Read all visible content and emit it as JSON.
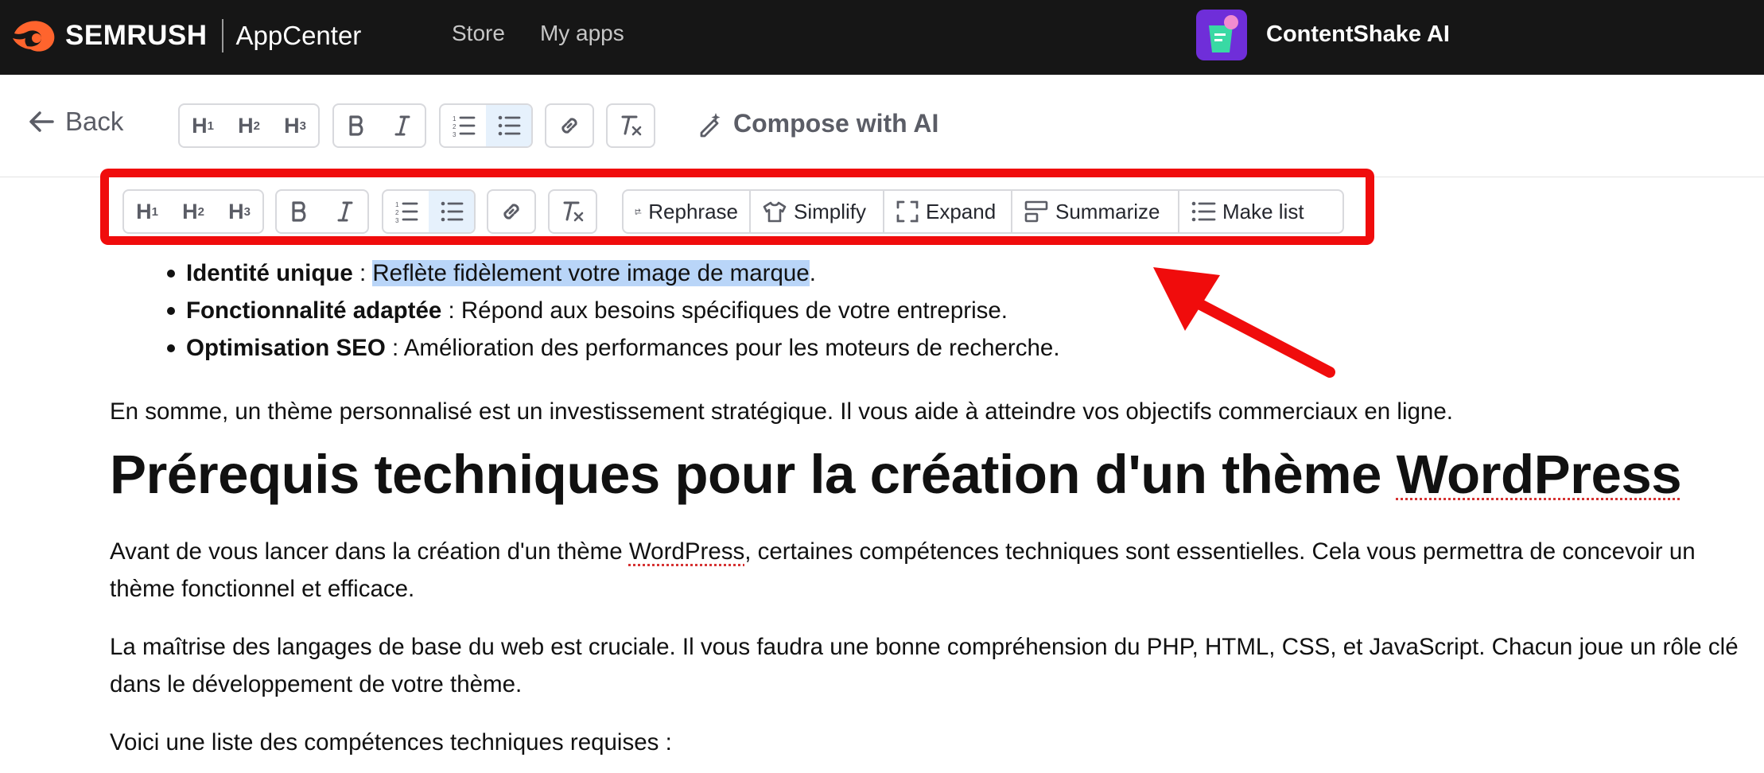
{
  "header": {
    "brand": "SEMRUSH",
    "section": "AppCenter",
    "nav": [
      "Store",
      "My apps"
    ],
    "app_name": "ContentShake AI"
  },
  "toolbar": {
    "back_label": "Back",
    "headings": [
      "H",
      "H",
      "H"
    ],
    "heading_levels": [
      "1",
      "2",
      "3"
    ],
    "compose_label": "Compose with AI"
  },
  "bubble": {
    "headings": [
      "H",
      "H",
      "H"
    ],
    "heading_levels": [
      "1",
      "2",
      "3"
    ],
    "ai_actions": [
      "Rephrase",
      "Simplify",
      "Expand",
      "Summarize",
      "Make list"
    ]
  },
  "content": {
    "bullets": [
      {
        "bold": "Identité unique",
        "sep": " : ",
        "selected": "Reflète fidèlement votre image de marque",
        "rest": "."
      },
      {
        "bold": "Fonctionnalité adaptée",
        "sep": " : ",
        "rest": "Répond aux besoins spécifiques de votre entreprise."
      },
      {
        "bold": "Optimisation SEO",
        "sep": " : ",
        "rest": "Amélioration des performances pour les moteurs de recherche."
      }
    ],
    "p1": "En somme, un thème personnalisé est un investissement stratégique. Il vous aide à atteindre vos objectifs commerciaux en ligne.",
    "h1_main": "Prérequis techniques pour la création d'un thème ",
    "h1_word": "WordPress",
    "p2_a": "Avant de vous lancer dans la création d'un thème ",
    "p2_word": "WordPress",
    "p2_b": ", certaines compétences techniques sont essentielles. Cela vous permettra de concevoir un thème fonctionnel et efficace.",
    "p3": "La maîtrise des langages de base du web est cruciale. Il vous faudra une bonne compréhension du PHP, HTML, CSS, et JavaScript. Chacun joue un rôle clé dans le développement de votre thème.",
    "p4": "Voici une liste des compétences techniques requises :"
  },
  "colors": {
    "topbar": "#161616",
    "brand_orange": "#ff642d",
    "app_badge": "#6f2ed9",
    "annotation_red": "#f00c0c",
    "selection": "#b9d5f8"
  }
}
